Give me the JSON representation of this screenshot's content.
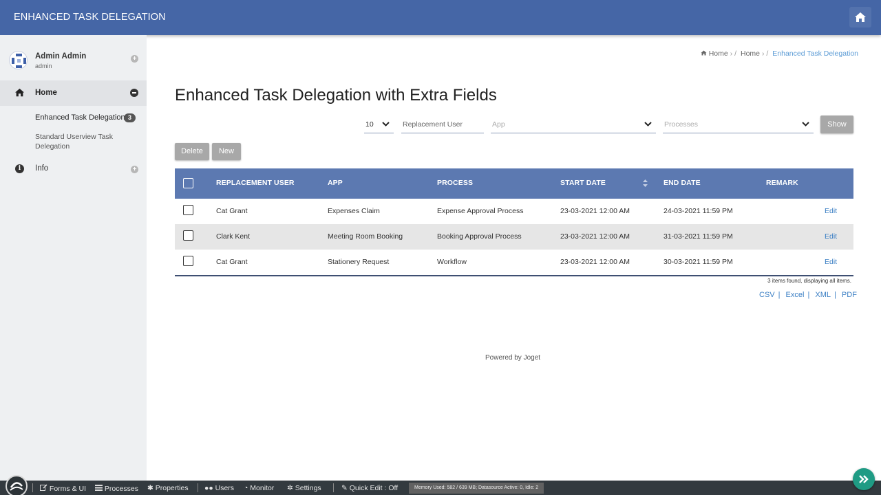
{
  "header": {
    "title": "ENHANCED TASK DELEGATION"
  },
  "sidebar": {
    "user": {
      "name": "Admin Admin",
      "username": "admin"
    },
    "menu": {
      "home_label": "Home",
      "sub_items": [
        {
          "label": "Enhanced Task Delegation",
          "badge": "3"
        },
        {
          "label": "Standard Userview Task Delegation"
        }
      ],
      "info_label": "Info"
    }
  },
  "breadcrumb": {
    "items": [
      "Home",
      "Home",
      "Enhanced Task Delegation"
    ]
  },
  "page": {
    "title": "Enhanced Task Delegation with Extra Fields"
  },
  "filters": {
    "page_size": "10",
    "replacement_user_placeholder": "Replacement User",
    "app_placeholder": "App",
    "processes_placeholder": "Processes",
    "show_label": "Show"
  },
  "actions": {
    "delete_label": "Delete",
    "new_label": "New"
  },
  "table": {
    "columns": [
      "REPLACEMENT USER",
      "APP",
      "PROCESS",
      "START DATE",
      "END DATE",
      "REMARK"
    ],
    "rows": [
      {
        "user": "Cat Grant",
        "app": "Expenses Claim",
        "process": "Expense Approval Process",
        "start": "23-03-2021 12:00 AM",
        "end": "24-03-2021 11:59 PM",
        "remark": "",
        "action": "Edit"
      },
      {
        "user": "Clark Kent",
        "app": "Meeting Room Booking",
        "process": "Booking Approval Process",
        "start": "23-03-2021 12:00 AM",
        "end": "31-03-2021 11:59 PM",
        "remark": "",
        "action": "Edit"
      },
      {
        "user": "Cat Grant",
        "app": "Stationery Request",
        "process": "Workflow",
        "start": "23-03-2021 12:00 AM",
        "end": "30-03-2021 11:59 PM",
        "remark": "",
        "action": "Edit"
      }
    ],
    "found_text": "3 items found, displaying all items.",
    "exports": [
      "CSV",
      "Excel",
      "XML",
      "PDF"
    ]
  },
  "footer": {
    "powered": "Powered by Joget"
  },
  "adminbar": {
    "items": [
      "Forms & UI",
      "Processes",
      "Properties",
      "Users",
      "Monitor",
      "Settings",
      "Quick Edit : Off"
    ],
    "memory": "Memory Used: 582 / 639 MB; Datasource Active: 0, Idle: 2"
  },
  "colors": {
    "header": "#4566a6",
    "table_header": "#5c79b1",
    "link": "#3b7fc4",
    "fab": "#1f9b84"
  }
}
